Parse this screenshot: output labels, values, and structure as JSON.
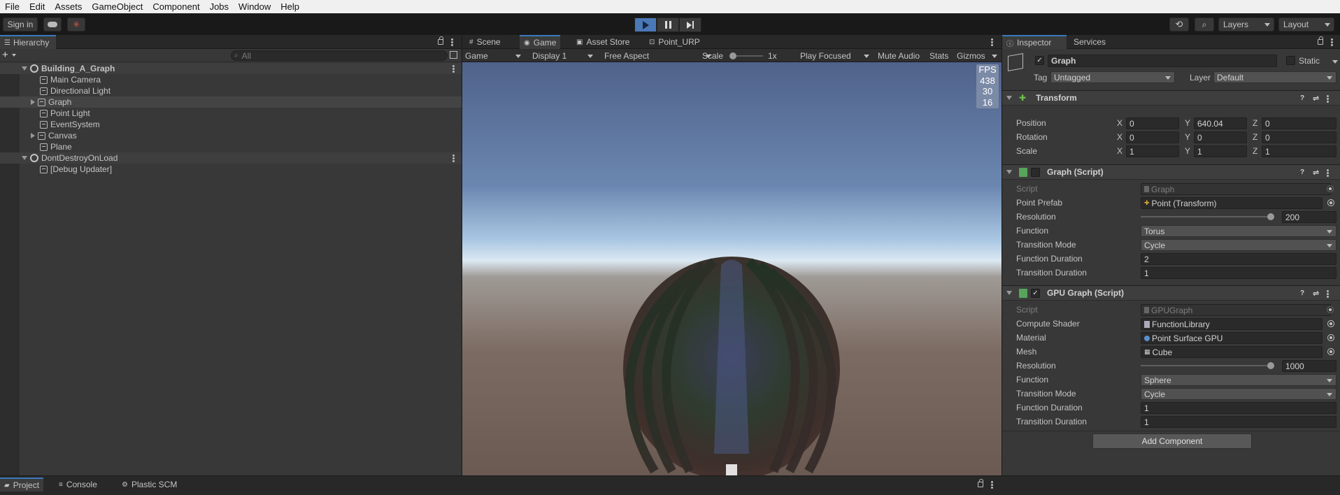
{
  "menu": [
    "File",
    "Edit",
    "Assets",
    "GameObject",
    "Component",
    "Jobs",
    "Window",
    "Help"
  ],
  "toolbar": {
    "sign_in": "Sign in",
    "layers": "Layers",
    "layout": "Layout"
  },
  "hierarchy": {
    "tab": "Hierarchy",
    "search_placeholder": "All",
    "items": [
      {
        "label": "Building_A_Graph",
        "kind": "scene"
      },
      {
        "label": "Main Camera",
        "kind": "object"
      },
      {
        "label": "Directional Light",
        "kind": "object"
      },
      {
        "label": "Graph",
        "kind": "object-collapsed"
      },
      {
        "label": "Point Light",
        "kind": "object"
      },
      {
        "label": "EventSystem",
        "kind": "object"
      },
      {
        "label": "Canvas",
        "kind": "object-collapsed"
      },
      {
        "label": "Plane",
        "kind": "object"
      },
      {
        "label": "DontDestroyOnLoad",
        "kind": "scene"
      },
      {
        "label": "[Debug Updater]",
        "kind": "object"
      }
    ]
  },
  "center_tabs": [
    "Scene",
    "Game",
    "Asset Store",
    "Point_URP"
  ],
  "game_bar": {
    "mode": "Game",
    "display": "Display 1",
    "aspect": "Free Aspect",
    "scale_label": "Scale",
    "scale_value": "1x",
    "play_mode": "Play Focused",
    "mute": "Mute Audio",
    "stats": "Stats",
    "gizmos": "Gizmos"
  },
  "fps": [
    "FPS",
    "438",
    "30",
    "16"
  ],
  "inspector": {
    "tabs": [
      "Inspector",
      "Services"
    ],
    "object_name": "Graph",
    "static_label": "Static",
    "tag_label": "Tag",
    "tag_value": "Untagged",
    "layer_label": "Layer",
    "layer_value": "Default",
    "transform": {
      "title": "Transform",
      "position_label": "Position",
      "rotation_label": "Rotation",
      "scale_label": "Scale",
      "position": [
        "0",
        "640.04",
        "0"
      ],
      "rotation": [
        "0",
        "0",
        "0"
      ],
      "scale": [
        "1",
        "1",
        "1"
      ],
      "axes": [
        "X",
        "Y",
        "Z"
      ]
    },
    "graph_script": {
      "title": "Graph (Script)",
      "script_label": "Script",
      "script_value": "Graph",
      "point_prefab_label": "Point Prefab",
      "point_prefab_value": "Point (Transform)",
      "resolution_label": "Resolution",
      "resolution_value": "200",
      "resolution_fraction": 0.98,
      "function_label": "Function",
      "function_value": "Torus",
      "transition_mode_label": "Transition Mode",
      "transition_mode_value": "Cycle",
      "function_duration_label": "Function Duration",
      "function_duration_value": "2",
      "transition_duration_label": "Transition Duration",
      "transition_duration_value": "1"
    },
    "gpu_graph_script": {
      "title": "GPU Graph (Script)",
      "script_label": "Script",
      "script_value": "GPUGraph",
      "compute_shader_label": "Compute Shader",
      "compute_shader_value": "FunctionLibrary",
      "material_label": "Material",
      "material_value": "Point Surface GPU",
      "mesh_label": "Mesh",
      "mesh_value": "Cube",
      "resolution_label": "Resolution",
      "resolution_value": "1000",
      "resolution_fraction": 0.98,
      "function_label": "Function",
      "function_value": "Sphere",
      "transition_mode_label": "Transition Mode",
      "transition_mode_value": "Cycle",
      "function_duration_label": "Function Duration",
      "function_duration_value": "1",
      "transition_duration_label": "Transition Duration",
      "transition_duration_value": "1"
    },
    "add_component": "Add Component"
  },
  "bottom_tabs": [
    "Project",
    "Console",
    "Plastic SCM"
  ],
  "colors": {
    "accent": "#3a79bb",
    "play_active": "#4b78b7",
    "panel": "#383838",
    "field": "#2a2a2a"
  }
}
